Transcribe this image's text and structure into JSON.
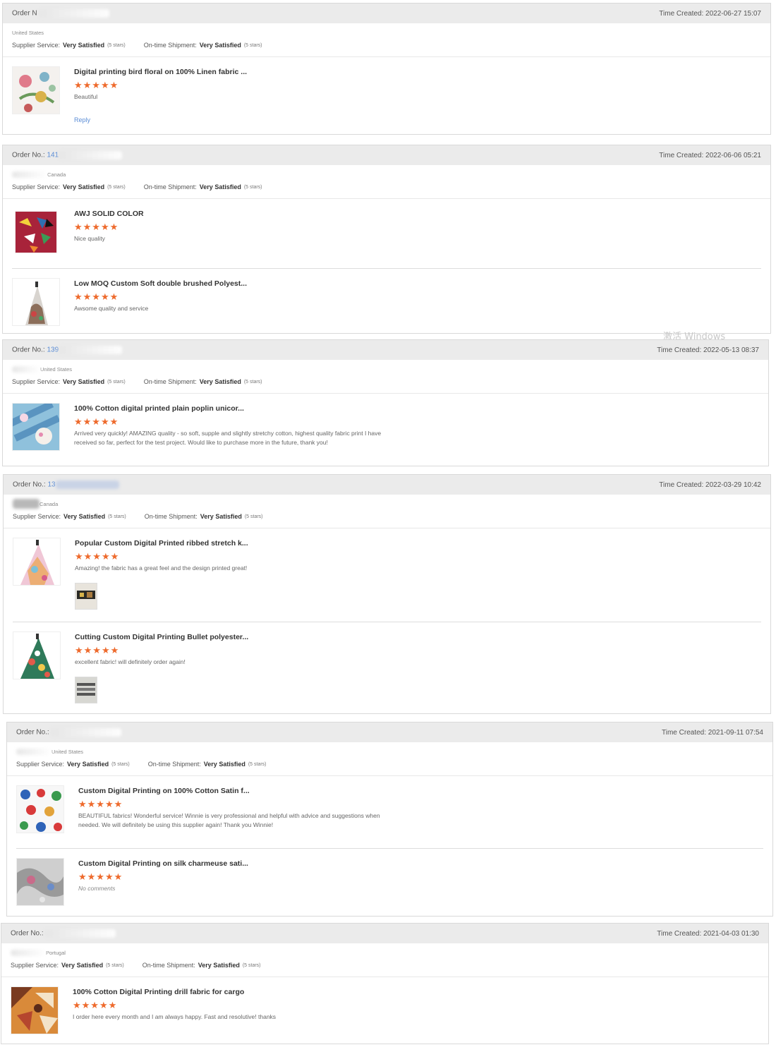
{
  "orders": [
    {
      "order_label": "Order N",
      "order_number": "",
      "time_created": "Time Created: 2022-06-27 15:07",
      "location": "United States",
      "supplier_service_label": "Supplier Service:",
      "supplier_service_value": "Very Satisfied",
      "supplier_service_stars": "(5 stars)",
      "shipment_label": "On-time Shipment:",
      "shipment_value": "Very Satisfied",
      "shipment_stars": "(5 stars)",
      "items": [
        {
          "title": "Digital printing bird floral on 100% Linen fabric ...",
          "rating": "★★★★★",
          "comment": "Beautiful",
          "reply": "Reply"
        }
      ]
    },
    {
      "order_label": "Order No.:",
      "order_number": "141",
      "time_created": "Time Created: 2022-06-06 05:21",
      "location": "Canada",
      "supplier_service_label": "Supplier Service:",
      "supplier_service_value": "Very Satisfied",
      "supplier_service_stars": "(5 stars)",
      "shipment_label": "On-time Shipment:",
      "shipment_value": "Very Satisfied",
      "shipment_stars": "(5 stars)",
      "items": [
        {
          "title": "AWJ SOLID COLOR",
          "rating": "★★★★★",
          "comment": "Nice quality"
        },
        {
          "title": "Low MOQ Custom Soft double brushed Polyest...",
          "rating": "★★★★★",
          "comment": "Awsome quality and service"
        }
      ]
    },
    {
      "order_label": "Order No.:",
      "order_number": "139",
      "time_created": "Time Created: 2022-05-13 08:37",
      "location": "United States",
      "supplier_service_label": "Supplier Service:",
      "supplier_service_value": "Very Satisfied",
      "supplier_service_stars": "(5 stars)",
      "shipment_label": "On-time Shipment:",
      "shipment_value": "Very Satisfied",
      "shipment_stars": "(5 stars)",
      "items": [
        {
          "title": "100% Cotton digital printed plain poplin unicor...",
          "rating": "★★★★★",
          "comment": "Arrived very quickly! AMAZING quality - so soft, supple and slightly stretchy cotton, highest quality fabric print I have received so far, perfect for the test project. Would like to purchase more in the future, thank you!"
        }
      ]
    },
    {
      "order_label": "Order No.:",
      "order_number": "13",
      "time_created": "Time Created: 2022-03-29 10:42",
      "location": "Canada",
      "supplier_service_label": "Supplier Service:",
      "supplier_service_value": "Very Satisfied",
      "supplier_service_stars": "(5 stars)",
      "shipment_label": "On-time Shipment:",
      "shipment_value": "Very Satisfied",
      "shipment_stars": "(5 stars)",
      "items": [
        {
          "title": "Popular Custom Digital Printed ribbed stretch k...",
          "rating": "★★★★★",
          "comment": "Amazing! the fabric has a great feel and the design printed great!"
        },
        {
          "title": "Cutting Custom Digital Printing Bullet polyester...",
          "rating": "★★★★★",
          "comment": "excellent fabric! will definitely order again!"
        }
      ]
    },
    {
      "order_label": "Order No.:",
      "order_number": "",
      "time_created": "Time Created: 2021-09-11 07:54",
      "location": "United States",
      "supplier_service_label": "Supplier Service:",
      "supplier_service_value": "Very Satisfied",
      "supplier_service_stars": "(5 stars)",
      "shipment_label": "On-time Shipment:",
      "shipment_value": "Very Satisfied",
      "shipment_stars": "(5 stars)",
      "items": [
        {
          "title": "Custom Digital Printing on 100% Cotton Satin f...",
          "rating": "★★★★★",
          "comment": "BEAUTIFUL fabrics!  Wonderful service!  Winnie is very professional and helpful with advice and suggestions when needed.  We will definitely be using this supplier again!  Thank you Winnie!"
        },
        {
          "title": "Custom Digital Printing on silk charmeuse sati...",
          "rating": "★★★★★",
          "comment": "No comments"
        }
      ]
    },
    {
      "order_label": "Order No.:",
      "order_number": "",
      "time_created": "Time Created: 2021-04-03 01:30",
      "location": "Portugal",
      "supplier_service_label": "Supplier Service:",
      "supplier_service_value": "Very Satisfied",
      "supplier_service_stars": "(5 stars)",
      "shipment_label": "On-time Shipment:",
      "shipment_value": "Very Satisfied",
      "shipment_stars": "(5 stars)",
      "items": [
        {
          "title": "100% Cotton Digital Printing drill fabric for cargo",
          "rating": "★★★★★",
          "comment": "I order here every month and I am always happy.  Fast and resolutive! thanks"
        }
      ]
    }
  ],
  "watermark": "激活 Windows"
}
